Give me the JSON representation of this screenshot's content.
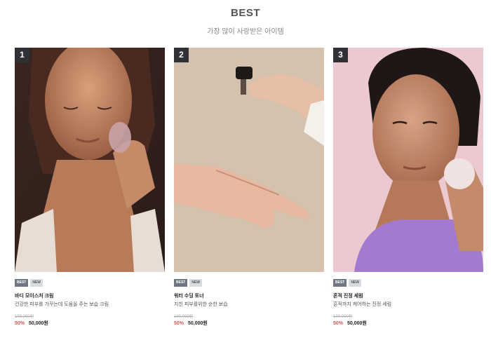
{
  "section": {
    "title": "BEST",
    "subtitle": "가장 많이 사랑받은 아이템"
  },
  "products": [
    {
      "rank": "1",
      "badges": [
        "BEST",
        "NEW"
      ],
      "name": "바디 모이스처 크림",
      "description": "건강한 피부를 가꾸는데 도움을 주는 보습 크림",
      "original_price": "100,000원",
      "discount": "50%",
      "price": "50,000원"
    },
    {
      "rank": "2",
      "badges": [
        "BEST",
        "NEW"
      ],
      "name": "워터 수딩 토너",
      "description": "지친 피부를위한 순한 보습",
      "original_price": "100,000원",
      "discount": "50%",
      "price": "50,000원"
    },
    {
      "rank": "3",
      "badges": [
        "BEST",
        "NEW"
      ],
      "name": "흔적 진정 세럼",
      "description": "흔적까지 케어하는 진정 세럼",
      "original_price": "100,000원",
      "discount": "50%",
      "price": "50,000원"
    }
  ],
  "colors": {
    "rank_bg": "#2f3136",
    "badge_best": "#6e7683",
    "badge_new": "#d8dbe0",
    "discount": "#d9534f"
  }
}
